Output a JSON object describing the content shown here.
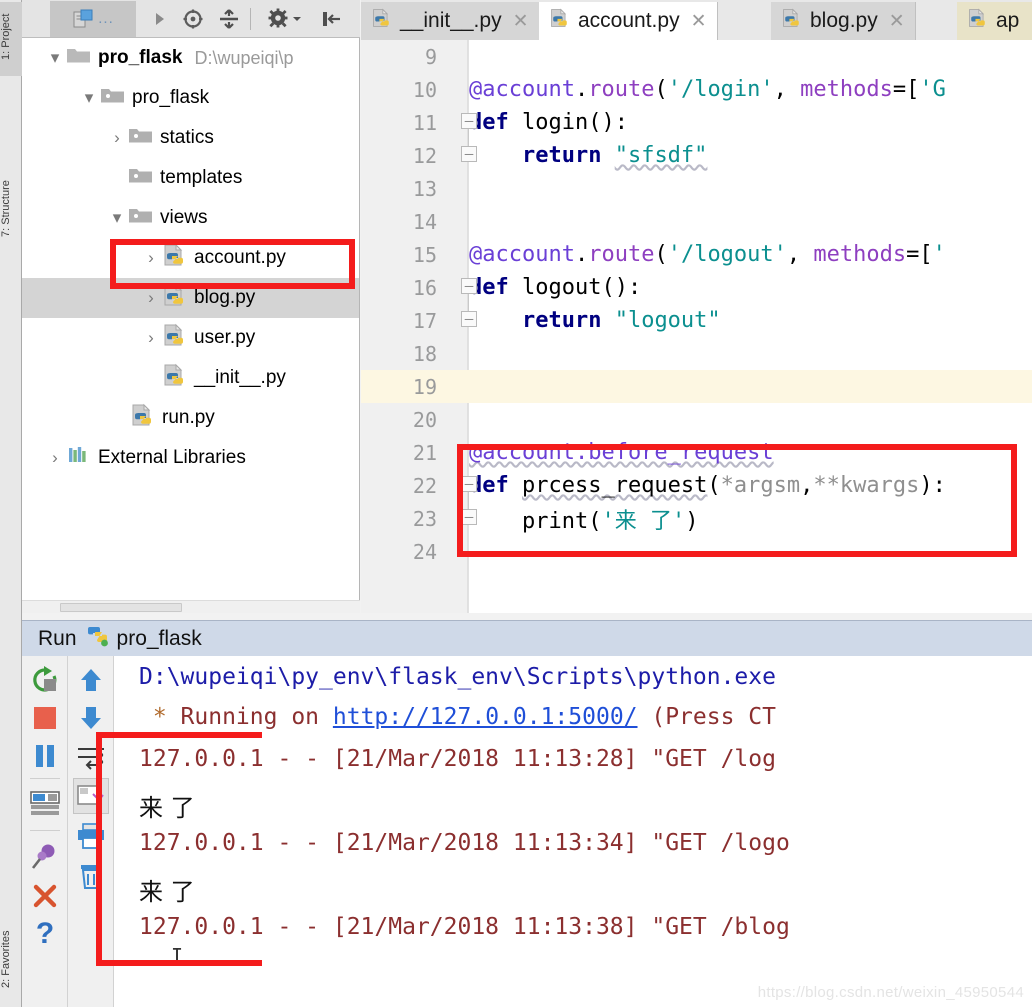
{
  "left_tool_tabs": [
    {
      "label": "1: Project",
      "selected": true
    },
    {
      "label": "7: Structure",
      "selected": false
    },
    {
      "label": "2: Favorites",
      "selected": false
    }
  ],
  "project_toolbar": {
    "selector_label": "...",
    "buttons": [
      {
        "name": "expand-run-icon",
        "glyph": "▶"
      },
      {
        "name": "locate-target-icon",
        "glyph": "⊕"
      },
      {
        "name": "collapse-all-icon",
        "glyph": "−"
      },
      {
        "name": "settings-gear-icon",
        "glyph": "⚙"
      },
      {
        "name": "hide-panel-icon",
        "glyph": "⇤"
      }
    ]
  },
  "project_tree": [
    {
      "label": "pro_flask",
      "path": "D:\\wupeiqi\\p",
      "icon": "folder-icon",
      "indent": 0,
      "arrow": "down",
      "bold": true,
      "selected": false
    },
    {
      "label": "pro_flask",
      "path": "",
      "icon": "folder-icon",
      "indent": 1,
      "arrow": "down",
      "bold": false,
      "selected": false
    },
    {
      "label": "statics",
      "path": "",
      "icon": "folder-icon",
      "indent": 2,
      "arrow": "right",
      "bold": false,
      "selected": false
    },
    {
      "label": "templates",
      "path": "",
      "icon": "folder-icon",
      "indent": 2,
      "arrow": "none",
      "bold": false,
      "selected": false
    },
    {
      "label": "views",
      "path": "",
      "icon": "folder-icon",
      "indent": 2,
      "arrow": "down",
      "bold": false,
      "selected": false
    },
    {
      "label": "account.py",
      "path": "",
      "icon": "python-file-icon",
      "indent": 3,
      "arrow": "right",
      "bold": false,
      "selected": false
    },
    {
      "label": "blog.py",
      "path": "",
      "icon": "python-file-icon",
      "indent": 3,
      "arrow": "right",
      "bold": false,
      "selected": true
    },
    {
      "label": "user.py",
      "path": "",
      "icon": "python-file-icon",
      "indent": 3,
      "arrow": "right",
      "bold": false,
      "selected": false
    },
    {
      "label": "__init__.py",
      "path": "",
      "icon": "python-file-icon",
      "indent": 3,
      "arrow": "none",
      "bold": false,
      "selected": false
    },
    {
      "label": "run.py",
      "path": "",
      "icon": "python-file-icon",
      "indent": 2,
      "arrow": "none",
      "bold": false,
      "selected": false
    },
    {
      "label": "External Libraries",
      "path": "",
      "icon": "libraries-icon",
      "indent": 0,
      "arrow": "right",
      "bold": false,
      "selected": false
    }
  ],
  "editor_tabs": [
    {
      "label": "__init__.py",
      "state": "inactive",
      "closable": true
    },
    {
      "label": "account.py",
      "state": "active",
      "closable": true
    },
    {
      "label": "blog.py",
      "state": "inactive",
      "closable": true
    },
    {
      "label": "ap",
      "state": "modified",
      "closable": false
    }
  ],
  "editor": {
    "first_line": 9,
    "current_line": 19,
    "lines": [
      {
        "n": 9,
        "text": ""
      },
      {
        "n": 10,
        "text": "@account.route('/login', methods=['G"
      },
      {
        "n": 11,
        "text": "def login():"
      },
      {
        "n": 12,
        "text": "    return \"sfsdf\""
      },
      {
        "n": 13,
        "text": ""
      },
      {
        "n": 14,
        "text": ""
      },
      {
        "n": 15,
        "text": "@account.route('/logout', methods=['"
      },
      {
        "n": 16,
        "text": "def logout():"
      },
      {
        "n": 17,
        "text": "    return \"logout\""
      },
      {
        "n": 18,
        "text": ""
      },
      {
        "n": 19,
        "text": ""
      },
      {
        "n": 20,
        "text": ""
      },
      {
        "n": 21,
        "text": "@account.before_request"
      },
      {
        "n": 22,
        "text": "def prcess_request(*argsm,**kwargs):"
      },
      {
        "n": 23,
        "text": "    print('来 了')"
      },
      {
        "n": 24,
        "text": ""
      }
    ]
  },
  "run_panel": {
    "title": "Run",
    "config_name": "pro_flask",
    "toolbar_left": [
      {
        "name": "rerun-icon",
        "color": "#3c9a3c"
      },
      {
        "name": "stop-icon",
        "color": "#e8604c"
      },
      {
        "name": "pause-icon",
        "color": "#3d8ad0"
      },
      {
        "name": "show-console-icon",
        "color": "#3d8ad0"
      },
      {
        "name": "pin-tab-icon",
        "color": "#8e5bb5"
      },
      {
        "name": "close-icon",
        "color": "#d8542f"
      },
      {
        "name": "help-icon",
        "color": "#2f6fbf"
      }
    ],
    "toolbar_right": [
      {
        "name": "scroll-up-icon",
        "color": "#3d8ad0"
      },
      {
        "name": "scroll-down-icon",
        "color": "#3d8ad0"
      },
      {
        "name": "soft-wrap-icon",
        "color": "#3a3a3a"
      },
      {
        "name": "scroll-to-end-icon",
        "color": "#7a7a7a"
      },
      {
        "name": "print-icon",
        "color": "#3d8ad0"
      },
      {
        "name": "clear-all-icon",
        "color": "#3d8ad0"
      }
    ],
    "output_lines": [
      {
        "kind": "path",
        "text": "D:\\wupeiqi\\py_env\\flask_env\\Scripts\\python.exe"
      },
      {
        "kind": "running",
        "star": " * ",
        "prefix": "Running on ",
        "url": "http://127.0.0.1:5000/",
        "suffix": " (Press CT"
      },
      {
        "kind": "log",
        "text": "127.0.0.1 - - [21/Mar/2018 11:13:28] \"GET /log"
      },
      {
        "kind": "cn",
        "text": "来 了"
      },
      {
        "kind": "log",
        "text": "127.0.0.1 - - [21/Mar/2018 11:13:34] \"GET /logo"
      },
      {
        "kind": "cn",
        "text": "来 了"
      },
      {
        "kind": "log",
        "text": "127.0.0.1 - - [21/Mar/2018 11:13:38] \"GET /blog"
      }
    ]
  },
  "annotations": {
    "box_color": "#f41c1c",
    "boxes": [
      {
        "name": "highlight-account-py-tree"
      },
      {
        "name": "highlight-before-request-code"
      },
      {
        "name": "highlight-console-output"
      }
    ]
  },
  "watermark": {
    "text": "https://blog.csdn.net/weixin_45950544"
  }
}
